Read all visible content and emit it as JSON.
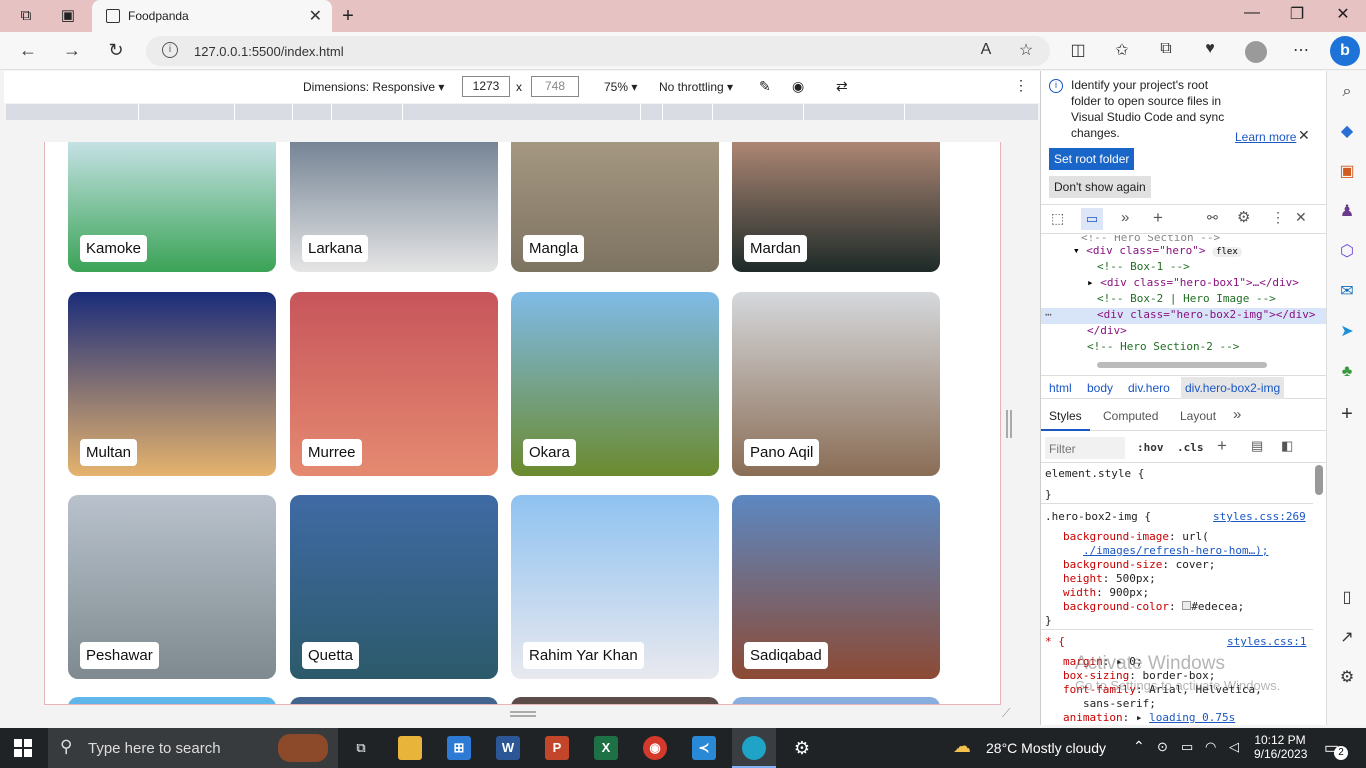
{
  "browser": {
    "tab_title": "Foodpanda",
    "url": "127.0.0.1:5500/index.html",
    "new_tab": "+"
  },
  "device_toolbar": {
    "dimensions_label": "Dimensions: Responsive",
    "width": "1273",
    "height": "748",
    "zoom": "75%",
    "throttling": "No throttling"
  },
  "cities": [
    {
      "name": "Kamoke",
      "colors": [
        "#cfe6ef",
        "#3aa356"
      ]
    },
    {
      "name": "Larkana",
      "colors": [
        "#6d7d8f",
        "#e5e5e5"
      ]
    },
    {
      "name": "Mangla",
      "colors": [
        "#a89a84",
        "#7d7361"
      ]
    },
    {
      "name": "Mardan",
      "colors": [
        "#b88d7a",
        "#1d2a28"
      ]
    },
    {
      "name": "Multan",
      "colors": [
        "#1a2c7a",
        "#e6b36d"
      ]
    },
    {
      "name": "Murree",
      "colors": [
        "#c7555b",
        "#e58a71"
      ]
    },
    {
      "name": "Okara",
      "colors": [
        "#7fbbe8",
        "#6b8a2e"
      ]
    },
    {
      "name": "Pano Aqil",
      "colors": [
        "#d5d8dc",
        "#8a6d55"
      ]
    },
    {
      "name": "Peshawar",
      "colors": [
        "#b9c2cc",
        "#7e8a8f"
      ]
    },
    {
      "name": "Quetta",
      "colors": [
        "#3f6aa5",
        "#2c5a6a"
      ]
    },
    {
      "name": "Rahim Yar Khan",
      "colors": [
        "#8fc2f0",
        "#e9e9ef"
      ]
    },
    {
      "name": "Sadiqabad",
      "colors": [
        "#5c88c2",
        "#8c4a34"
      ]
    }
  ],
  "devtools": {
    "notice": [
      "Identify your project's root",
      "folder to open source files in",
      "Visual Studio Code and sync",
      "changes."
    ],
    "learn_more": "Learn more",
    "set_root": "Set root folder",
    "dont_show": "Don't show again",
    "dom": [
      {
        "text": "<div class=\"hero\">",
        "badge": "flex"
      },
      {
        "text": "<!-- Box-1 -->"
      },
      {
        "text": "<div class=\"hero-box1\">…</div>"
      },
      {
        "text": "<!-- Box-2 | Hero Image -->"
      },
      {
        "text": "<div class=\"hero-box2-img\"></div>"
      },
      {
        "text": "</div>"
      },
      {
        "text": "<!-- Hero Section-2 -->"
      }
    ],
    "breadcrumbs": [
      "html",
      "body",
      "div.hero",
      "div.hero-box2-img"
    ],
    "panel_tabs": [
      "Styles",
      "Computed",
      "Layout"
    ],
    "filter_placeholder": "Filter",
    "hov": ":hov",
    "cls": ".cls",
    "element_style": "element.style {",
    "rule1": {
      "selector": ".hero-box2-img {",
      "source": "styles.css:269",
      "props": [
        [
          "background-image",
          "url("
        ],
        [
          "",
          "./images/refresh-hero-hom…);"
        ],
        [
          "background-size",
          "cover;"
        ],
        [
          "height",
          "500px;"
        ],
        [
          "width",
          "900px;"
        ],
        [
          "background-color",
          "#edecea;"
        ]
      ]
    },
    "rule2": {
      "selector": "* {",
      "source": "styles.css:1",
      "props": [
        [
          "margin",
          "0;"
        ],
        [
          "box-sizing",
          "border-box;"
        ],
        [
          "font-family",
          "Arial, Helvetica,"
        ],
        [
          "",
          "sans-serif;"
        ],
        [
          "animation",
          "loading 0.75s"
        ]
      ]
    },
    "watermark": [
      "Activate Windows",
      "Go to Settings to activate Windows."
    ]
  },
  "taskbar": {
    "search_placeholder": "Type here to search",
    "weather": "28°C  Mostly cloudy",
    "time": "10:12 PM",
    "date": "9/16/2023",
    "notifications": "2"
  }
}
